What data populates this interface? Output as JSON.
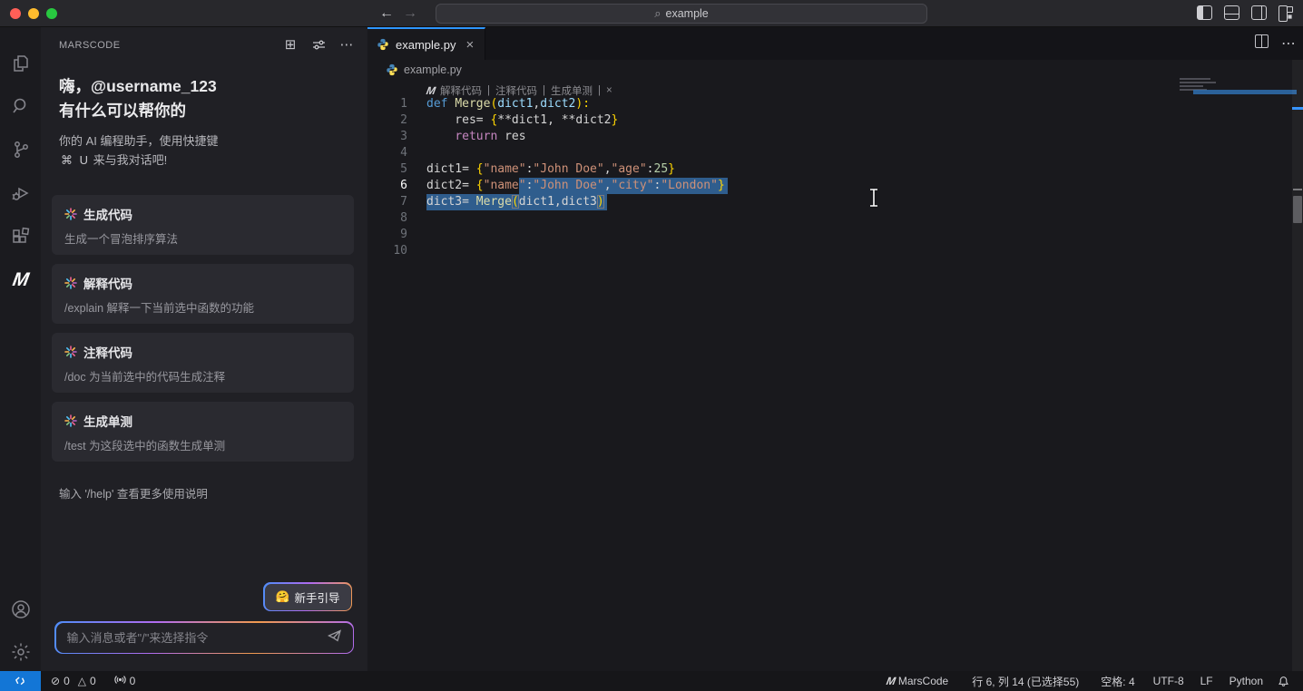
{
  "colors": {
    "accent": "#2e96ff",
    "selection": "#2f5d8d",
    "remote_blue": "#1376d6",
    "gradient": [
      "#4f8df7",
      "#b06bf0",
      "#f09a4e"
    ]
  },
  "titlebar": {
    "search_value": "example"
  },
  "activitybar": {
    "items": [
      "explorer",
      "search",
      "source-control",
      "run-debug",
      "extensions",
      "marscode",
      "account",
      "settings"
    ]
  },
  "sidebar": {
    "title": "MARSCODE",
    "greeting_line1": "嗨，@username_123",
    "greeting_line2": "有什么可以帮你的",
    "intro_line1": "你的 AI 编程助手，使用快捷键",
    "intro_key1": "⌘",
    "intro_key2": "U",
    "intro_line2": "来与我对话吧!",
    "cards": [
      {
        "title": "生成代码",
        "desc": "生成一个冒泡排序算法"
      },
      {
        "title": "解释代码",
        "desc": "/explain 解释一下当前选中函数的功能"
      },
      {
        "title": "注释代码",
        "desc": "/doc 为当前选中的代码生成注释"
      },
      {
        "title": "生成单测",
        "desc": "/test 为这段选中的函数生成单测"
      }
    ],
    "help_line": "输入 '/help' 查看更多使用说明",
    "guide_button": {
      "emoji": "🤗",
      "label": "新手引导"
    },
    "chat_placeholder": "输入消息或者\"/\"来选择指令"
  },
  "editor": {
    "tab": {
      "label": "example.py",
      "close": "×"
    },
    "breadcrumb": "example.py",
    "codelens": {
      "actions": [
        "解释代码",
        "注释代码",
        "生成单测"
      ],
      "close": "×"
    },
    "code": {
      "lines": [
        {
          "n": 1,
          "tokens": [
            [
              "def",
              "kw"
            ],
            [
              " ",
              "plain"
            ],
            [
              "Merge",
              "fn"
            ],
            [
              "(",
              "br"
            ],
            [
              "dict1",
              "param"
            ],
            [
              ",",
              "plain"
            ],
            [
              "dict2",
              "param"
            ],
            [
              "):",
              "br"
            ]
          ]
        },
        {
          "n": 2,
          "tokens": [
            [
              "    res= ",
              "plain"
            ],
            [
              "{",
              "br"
            ],
            [
              "**dict1, **dict2",
              "plain"
            ],
            [
              "}",
              "br"
            ]
          ]
        },
        {
          "n": 3,
          "tokens": [
            [
              "    ",
              "plain"
            ],
            [
              "return",
              "kw2"
            ],
            [
              " res",
              "plain"
            ]
          ]
        },
        {
          "n": 4,
          "tokens": []
        },
        {
          "n": 5,
          "tokens": [
            [
              "dict1= ",
              "plain"
            ],
            [
              "{",
              "br"
            ],
            [
              "\"name\"",
              "str"
            ],
            [
              ":",
              "plain"
            ],
            [
              "\"John Doe\"",
              "str"
            ],
            [
              ",",
              "plain"
            ],
            [
              "\"age\"",
              "str"
            ],
            [
              ":",
              "plain"
            ],
            [
              "25",
              "num"
            ],
            [
              "}",
              "br"
            ]
          ]
        },
        {
          "n": 6,
          "active": true,
          "sel": {
            "from": 13,
            "to": 42.4
          },
          "tokens": [
            [
              "dict2= ",
              "plain"
            ],
            [
              "{",
              "br"
            ],
            [
              "\"name\"",
              "str"
            ],
            [
              ":",
              "plain"
            ],
            [
              "\"John Doe\"",
              "str"
            ],
            [
              ",",
              "plain"
            ],
            [
              "\"city\"",
              "str"
            ],
            [
              ":",
              "plain"
            ],
            [
              "\"London\"",
              "str"
            ],
            [
              "}",
              "br"
            ]
          ]
        },
        {
          "n": 7,
          "sel": {
            "from": 0,
            "to": 25.4
          },
          "tokens": [
            [
              "dict3= ",
              "plain"
            ],
            [
              "Merge",
              "fn"
            ],
            [
              "(",
              "brm"
            ],
            [
              "dict1,dict3",
              "plain"
            ],
            [
              ")",
              "brm"
            ]
          ]
        },
        {
          "n": 8,
          "tokens": []
        },
        {
          "n": 9,
          "tokens": []
        },
        {
          "n": 10,
          "tokens": []
        }
      ]
    }
  },
  "statusbar": {
    "errors": "0",
    "warnings": "0",
    "ports": "0",
    "marscode": "MarsCode",
    "cursor": "行 6, 列 14 (已选择55)",
    "indent": "空格: 4",
    "encoding": "UTF-8",
    "eol": "LF",
    "language": "Python"
  }
}
